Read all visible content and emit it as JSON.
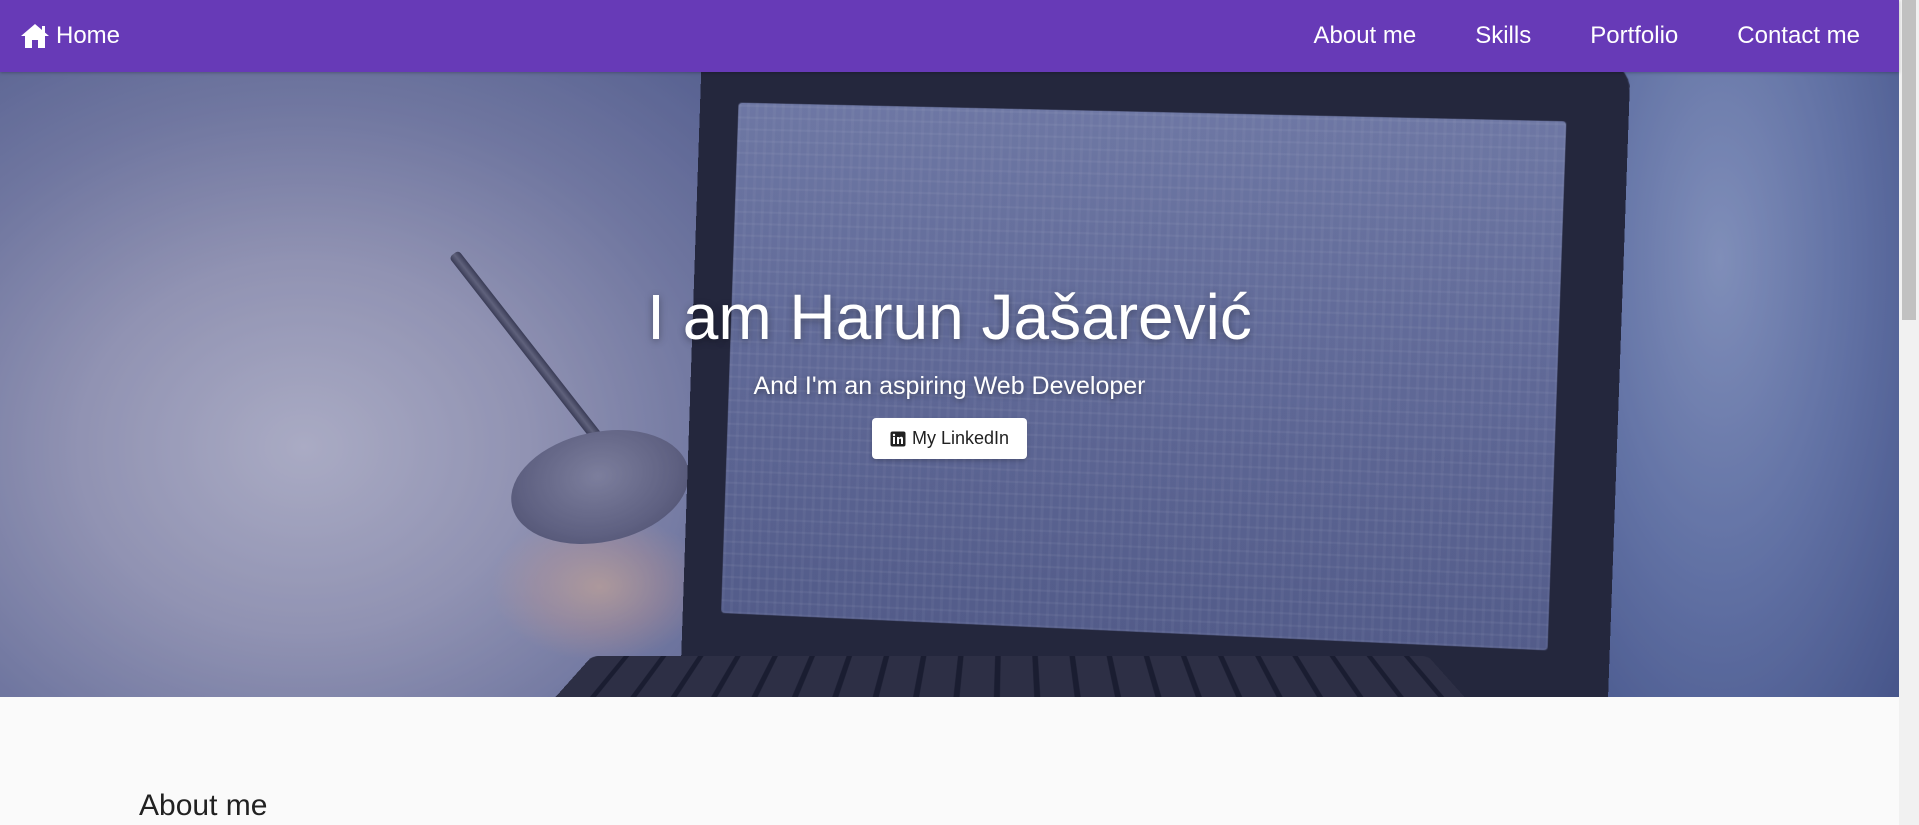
{
  "navbar": {
    "brand_label": "Home",
    "brand_icon": "home-icon",
    "links": [
      {
        "label": "About me"
      },
      {
        "label": "Skills"
      },
      {
        "label": "Portfolio"
      },
      {
        "label": "Contact me"
      }
    ],
    "background_color": "#673ab7"
  },
  "hero": {
    "title": "I am Harun Jašarević",
    "subtitle": "And I'm an aspiring Web Developer",
    "linkedin_button": {
      "label": "My LinkedIn",
      "icon": "linkedin-icon"
    }
  },
  "about": {
    "title": "About me"
  }
}
